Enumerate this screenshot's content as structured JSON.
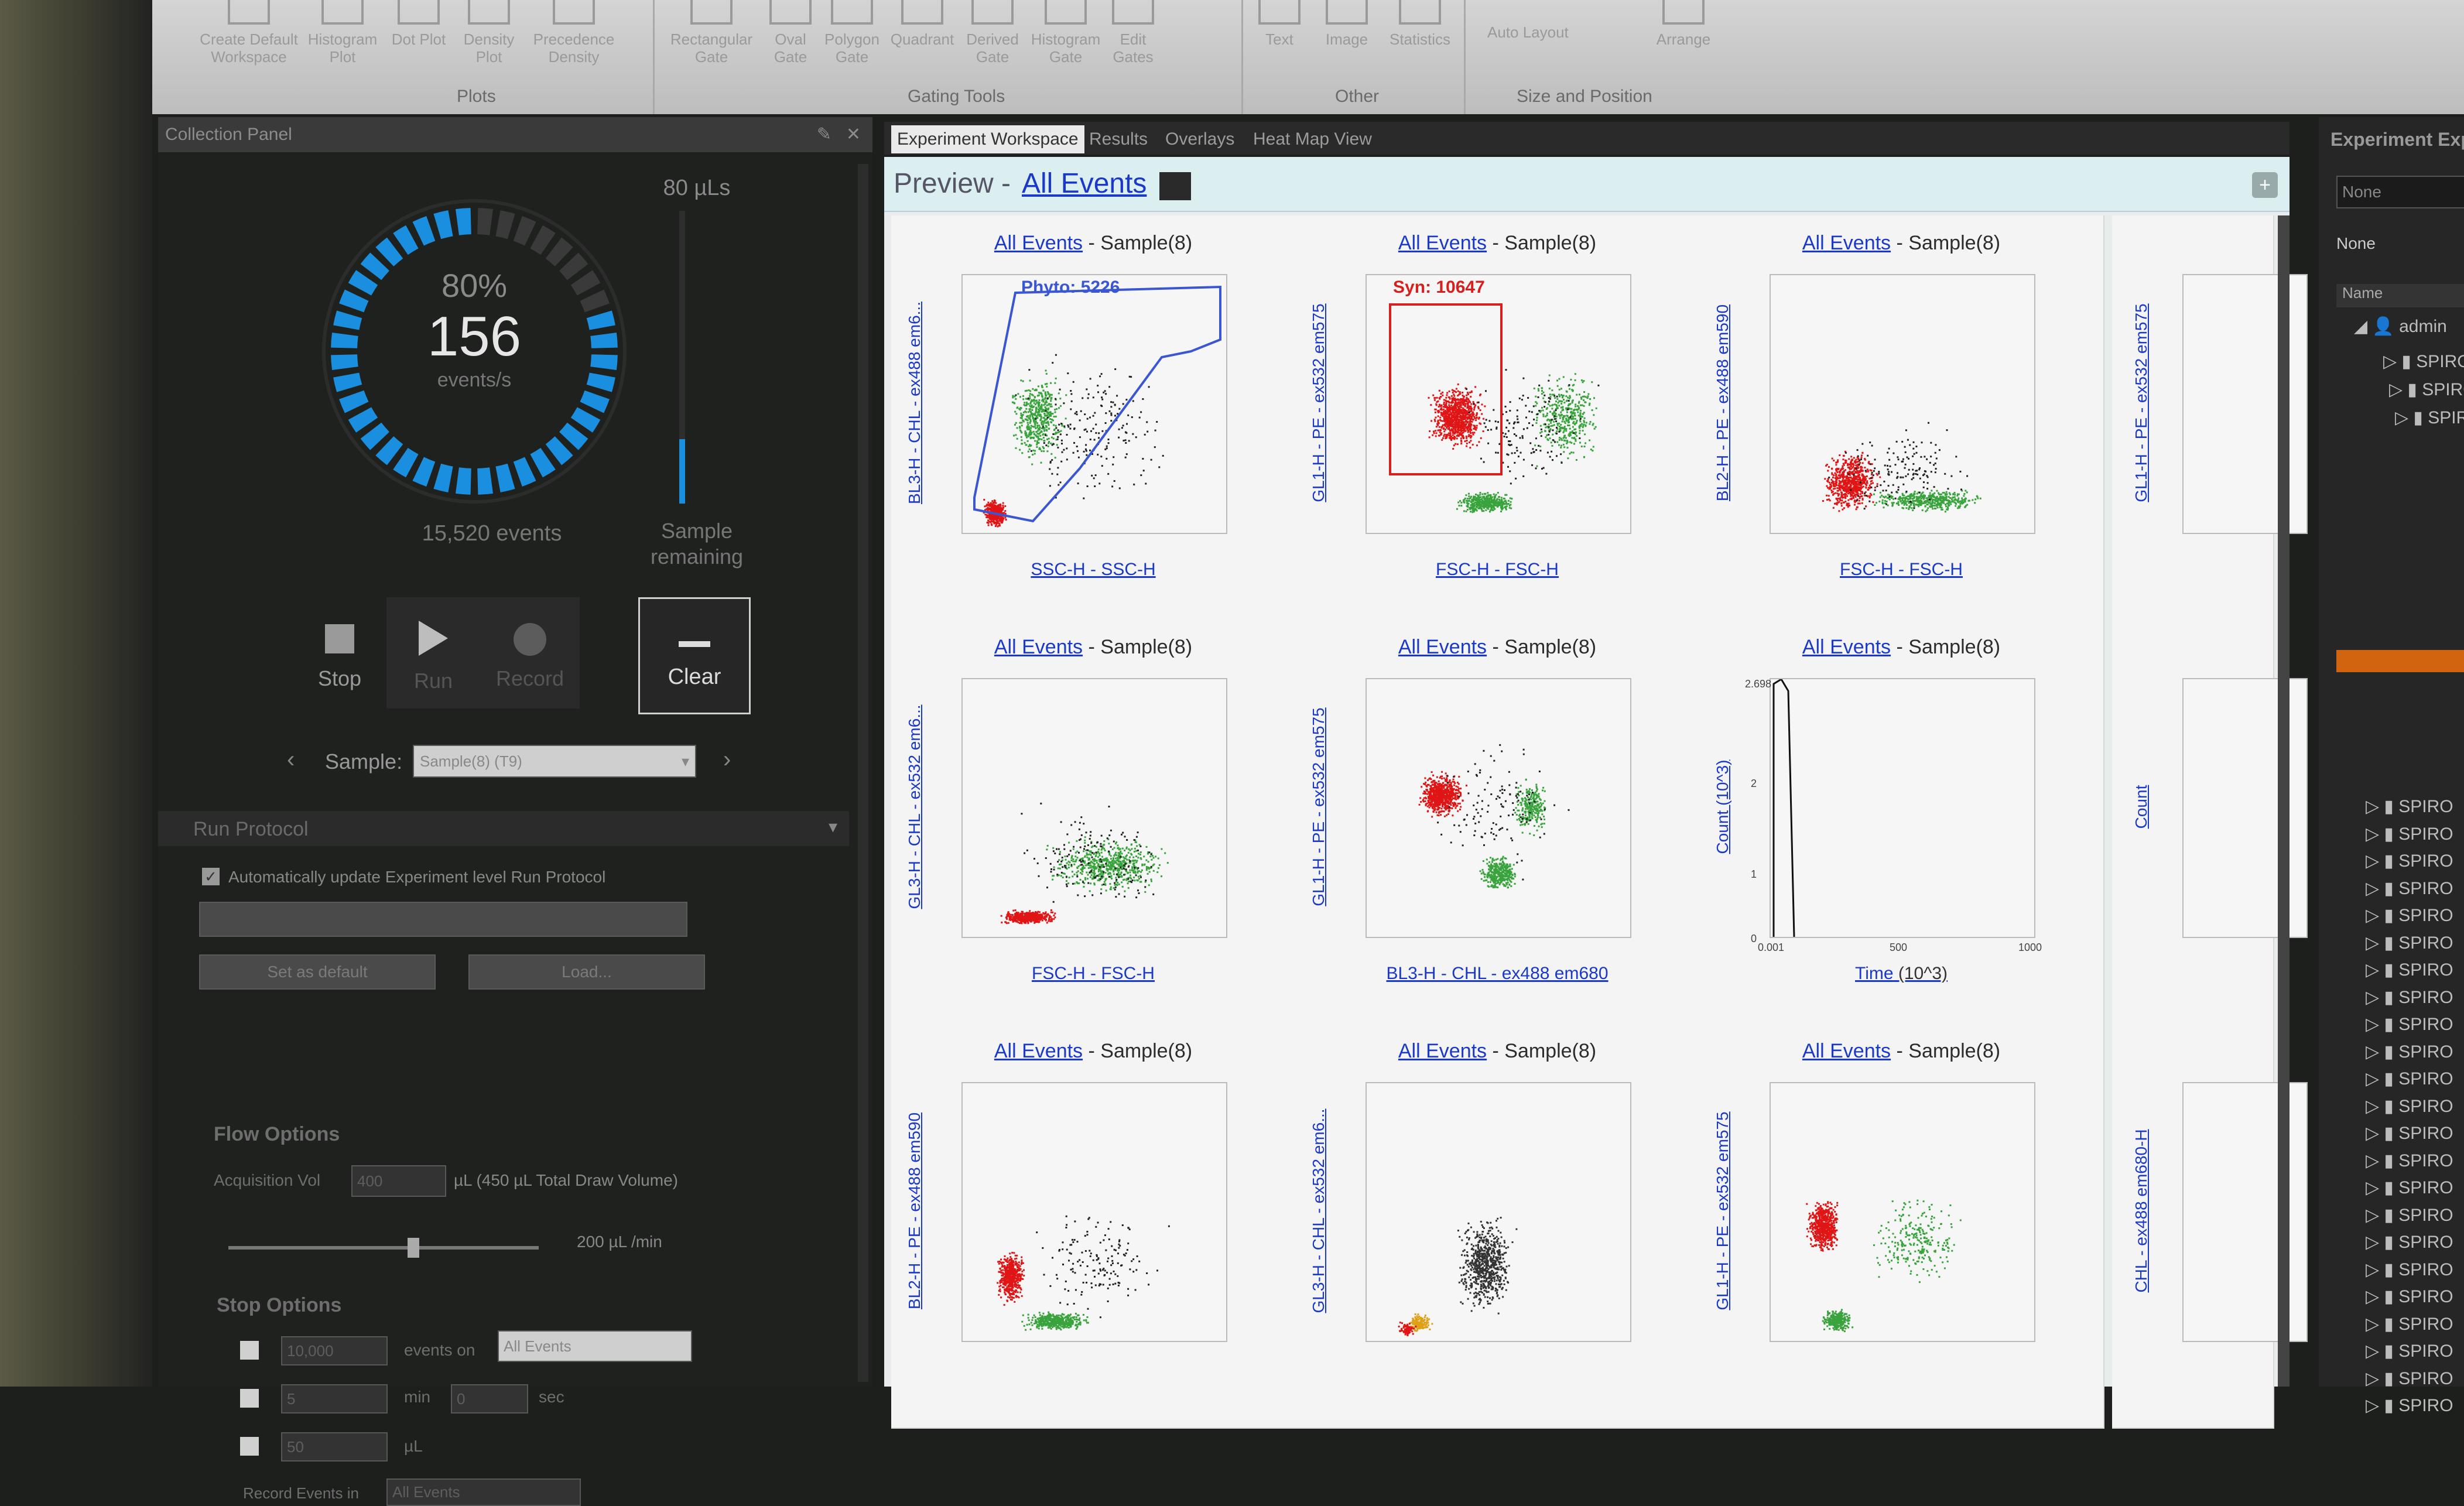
{
  "ribbon": {
    "items": [
      "Create Default Workspace",
      "Histogram Plot",
      "Dot Plot",
      "Density Plot",
      "Precedence Density",
      "Rectangular Gate",
      "Oval Gate",
      "Polygon Gate",
      "Quadrant",
      "Derived Gate",
      "Histogram Gate",
      "Edit Gates",
      "Text",
      "Image",
      "Statistics",
      "Auto Layout",
      "Arrange"
    ],
    "groups": {
      "plots": "Plots",
      "gating": "Gating Tools",
      "other": "Other",
      "size": "Size and Position"
    }
  },
  "collection": {
    "title": "Collection Panel",
    "percent": "80%",
    "rate": "156",
    "rate_unit": "events/s",
    "volume": "80 µLs",
    "events": "15,520 events",
    "remaining": "Sample remaining",
    "remaining_level": 0.22,
    "buttons": {
      "stop": "Stop",
      "run": "Run",
      "record": "Record",
      "clear": "Clear"
    },
    "sample_label": "Sample:",
    "sample_value": "Sample(8) (T9)"
  },
  "protocol": {
    "title": "Run Protocol",
    "auto_update": "Automatically update Experiment level Run Protocol",
    "set_default": "Set as default",
    "load": "Load...",
    "flow_options": "Flow Options",
    "acq_label": "Acquisition Vol",
    "acq_value": "400",
    "acq_suffix": "µL (450 µL Total Draw Volume)",
    "flow_rate": "200 µL /min",
    "flow_level": 0.6,
    "stop_options": "Stop Options",
    "stop1_value": "10,000",
    "stop1_label": "events on",
    "stop1_select": "All Events",
    "stop2_value": "5",
    "stop2_min": "min",
    "stop2_sec_value": "0",
    "stop2_sec": "sec",
    "stop3_value": "50",
    "stop3_unit": "µL",
    "record_label": "Record Events in",
    "record_value": "All Events"
  },
  "workspace": {
    "tabs": [
      "Experiment Workspace",
      "Results",
      "Overlays",
      "Heat Map View"
    ],
    "preview_label": "Preview -",
    "preview_link": "All Events",
    "plot_link": "All Events",
    "plot_sample": " - Sample(8)",
    "plots": [
      {
        "y": "BL3-H - CHL - ex488 em6...",
        "x": "SSC-H - SSC-H",
        "gate": "Phyto: 5226"
      },
      {
        "y": "GL1-H - PE - ex532 em575",
        "x": "FSC-H - FSC-H",
        "gate": "Syn: 10647"
      },
      {
        "y": "BL2-H - PE - ex488 em590",
        "x": "FSC-H - FSC-H",
        "gate": ""
      },
      {
        "y": "GL3-H - CHL - ex532 em6...",
        "x": "FSC-H - FSC-H",
        "gate": ""
      },
      {
        "y": "GL1-H - PE - ex532 em575",
        "x": "BL3-H - CHL - ex488 em680",
        "gate": ""
      },
      {
        "y": "Count (10^3)",
        "x": "Time",
        "x_suffix": " (10^3)",
        "gate": ""
      },
      {
        "y": "BL2-H - PE - ex488 em590",
        "x": "",
        "gate": ""
      },
      {
        "y": "GL3-H - CHL - ex532 em6...",
        "x": "",
        "gate": ""
      },
      {
        "y": "GL1-H - PE - ex532 em575",
        "x": "",
        "gate": ""
      }
    ],
    "partial_y": [
      "GL1-H - PE - ex532 em575",
      "Count",
      "CHL - ex488 em680-H"
    ],
    "hist_ticks": {
      "y_top": "2.698",
      "y_mid": "2",
      "y_low": "1",
      "y_zero": "0",
      "x0": "0.001",
      "x1": "500",
      "x2": "1000"
    }
  },
  "right_panel": {
    "title": "Experiment Exp",
    "dropdown": "None",
    "none_label": "None",
    "name_header": "Name",
    "user": "admin",
    "item": "SPIRO",
    "item_count": 27
  },
  "colors": {
    "accent": "#1a8fe0",
    "gate_red": "#d81f1f",
    "gate_blue": "#3a56d1",
    "link": "#1a39c9",
    "red_dots": "#e01515",
    "green_dots": "#39a33c"
  }
}
